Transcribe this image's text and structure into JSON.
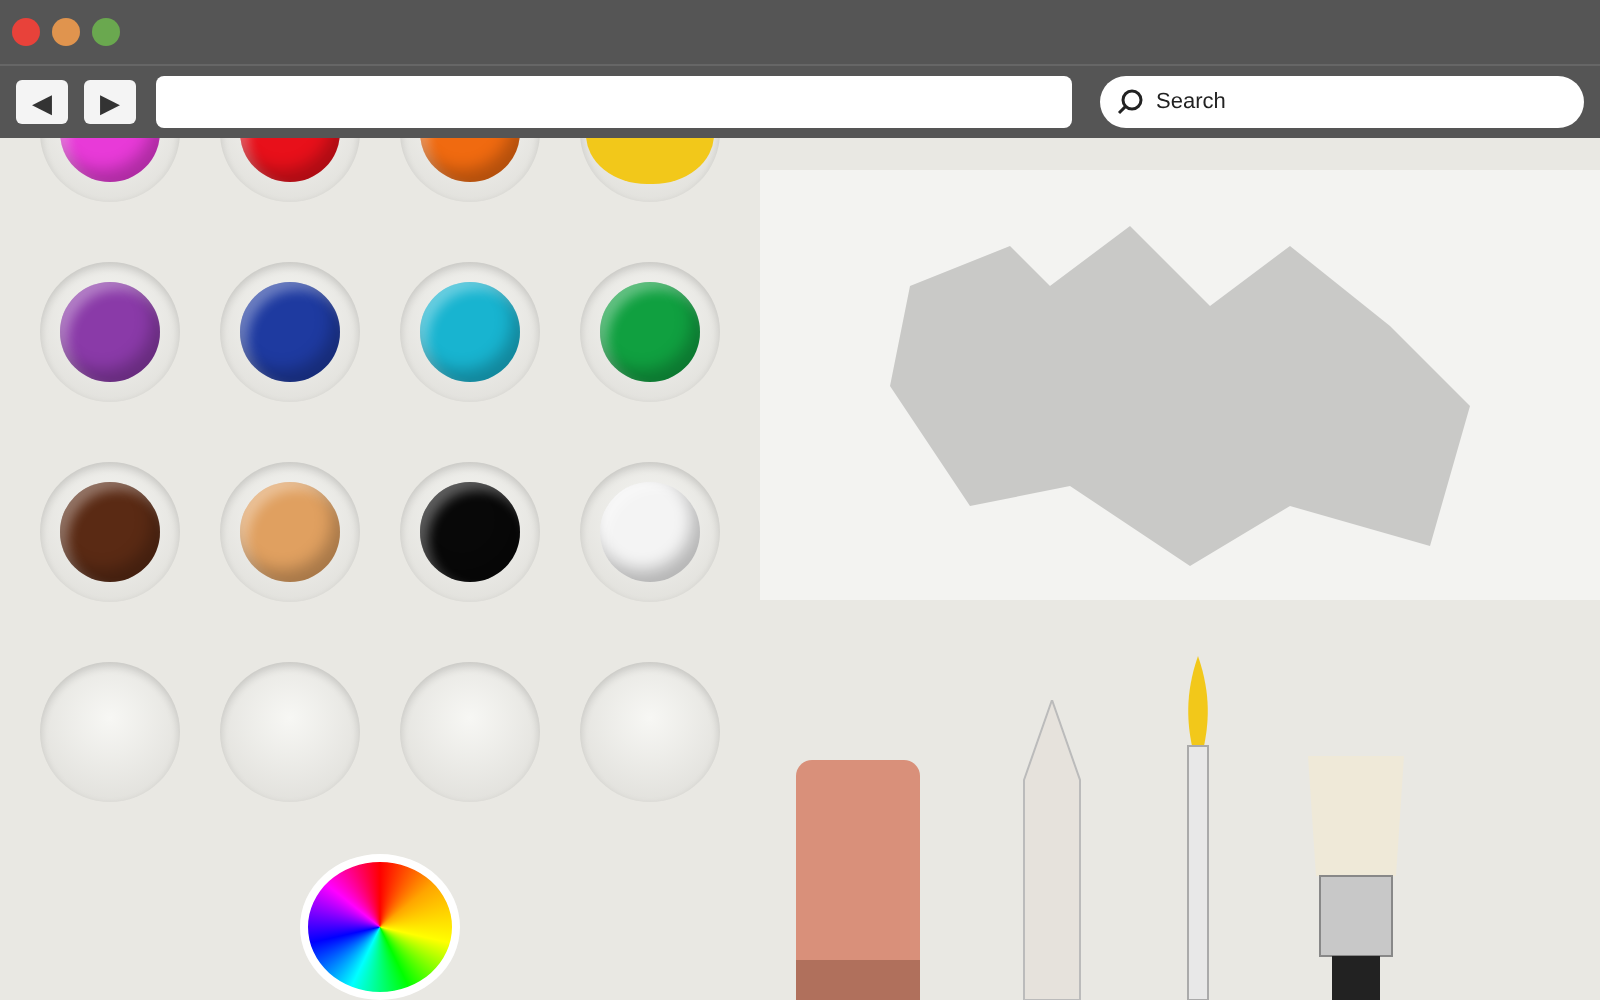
{
  "window": {
    "controls": [
      {
        "color": "#e8423a"
      },
      {
        "color": "#e0944e"
      },
      {
        "color": "#6aa84f"
      }
    ]
  },
  "toolbar": {
    "back": "◀",
    "forward": "▶",
    "search": {
      "placeholder": "Search"
    }
  },
  "palette": [
    {
      "kind": "paint",
      "color": "#e83ad8"
    },
    {
      "kind": "paint",
      "color": "#e8101a"
    },
    {
      "kind": "paint",
      "color": "#f06a10"
    },
    {
      "kind": "blob",
      "color": "#f2c81a"
    },
    {
      "kind": "paint",
      "color": "#8a3aa8"
    },
    {
      "kind": "paint",
      "color": "#1e3aa0"
    },
    {
      "kind": "paint",
      "color": "#18b4d0"
    },
    {
      "kind": "paint",
      "color": "#10a040"
    },
    {
      "kind": "paint",
      "color": "#5a2a14"
    },
    {
      "kind": "paint",
      "color": "#e0a060"
    },
    {
      "kind": "paint",
      "color": "#080808"
    },
    {
      "kind": "paint",
      "color": "#f4f4f4"
    },
    {
      "kind": "empty"
    },
    {
      "kind": "empty"
    },
    {
      "kind": "empty"
    },
    {
      "kind": "empty"
    }
  ],
  "tools": [
    {
      "kind": "eraser"
    },
    {
      "kind": "stump"
    },
    {
      "kind": "brush"
    },
    {
      "kind": "flat-brush"
    }
  ]
}
